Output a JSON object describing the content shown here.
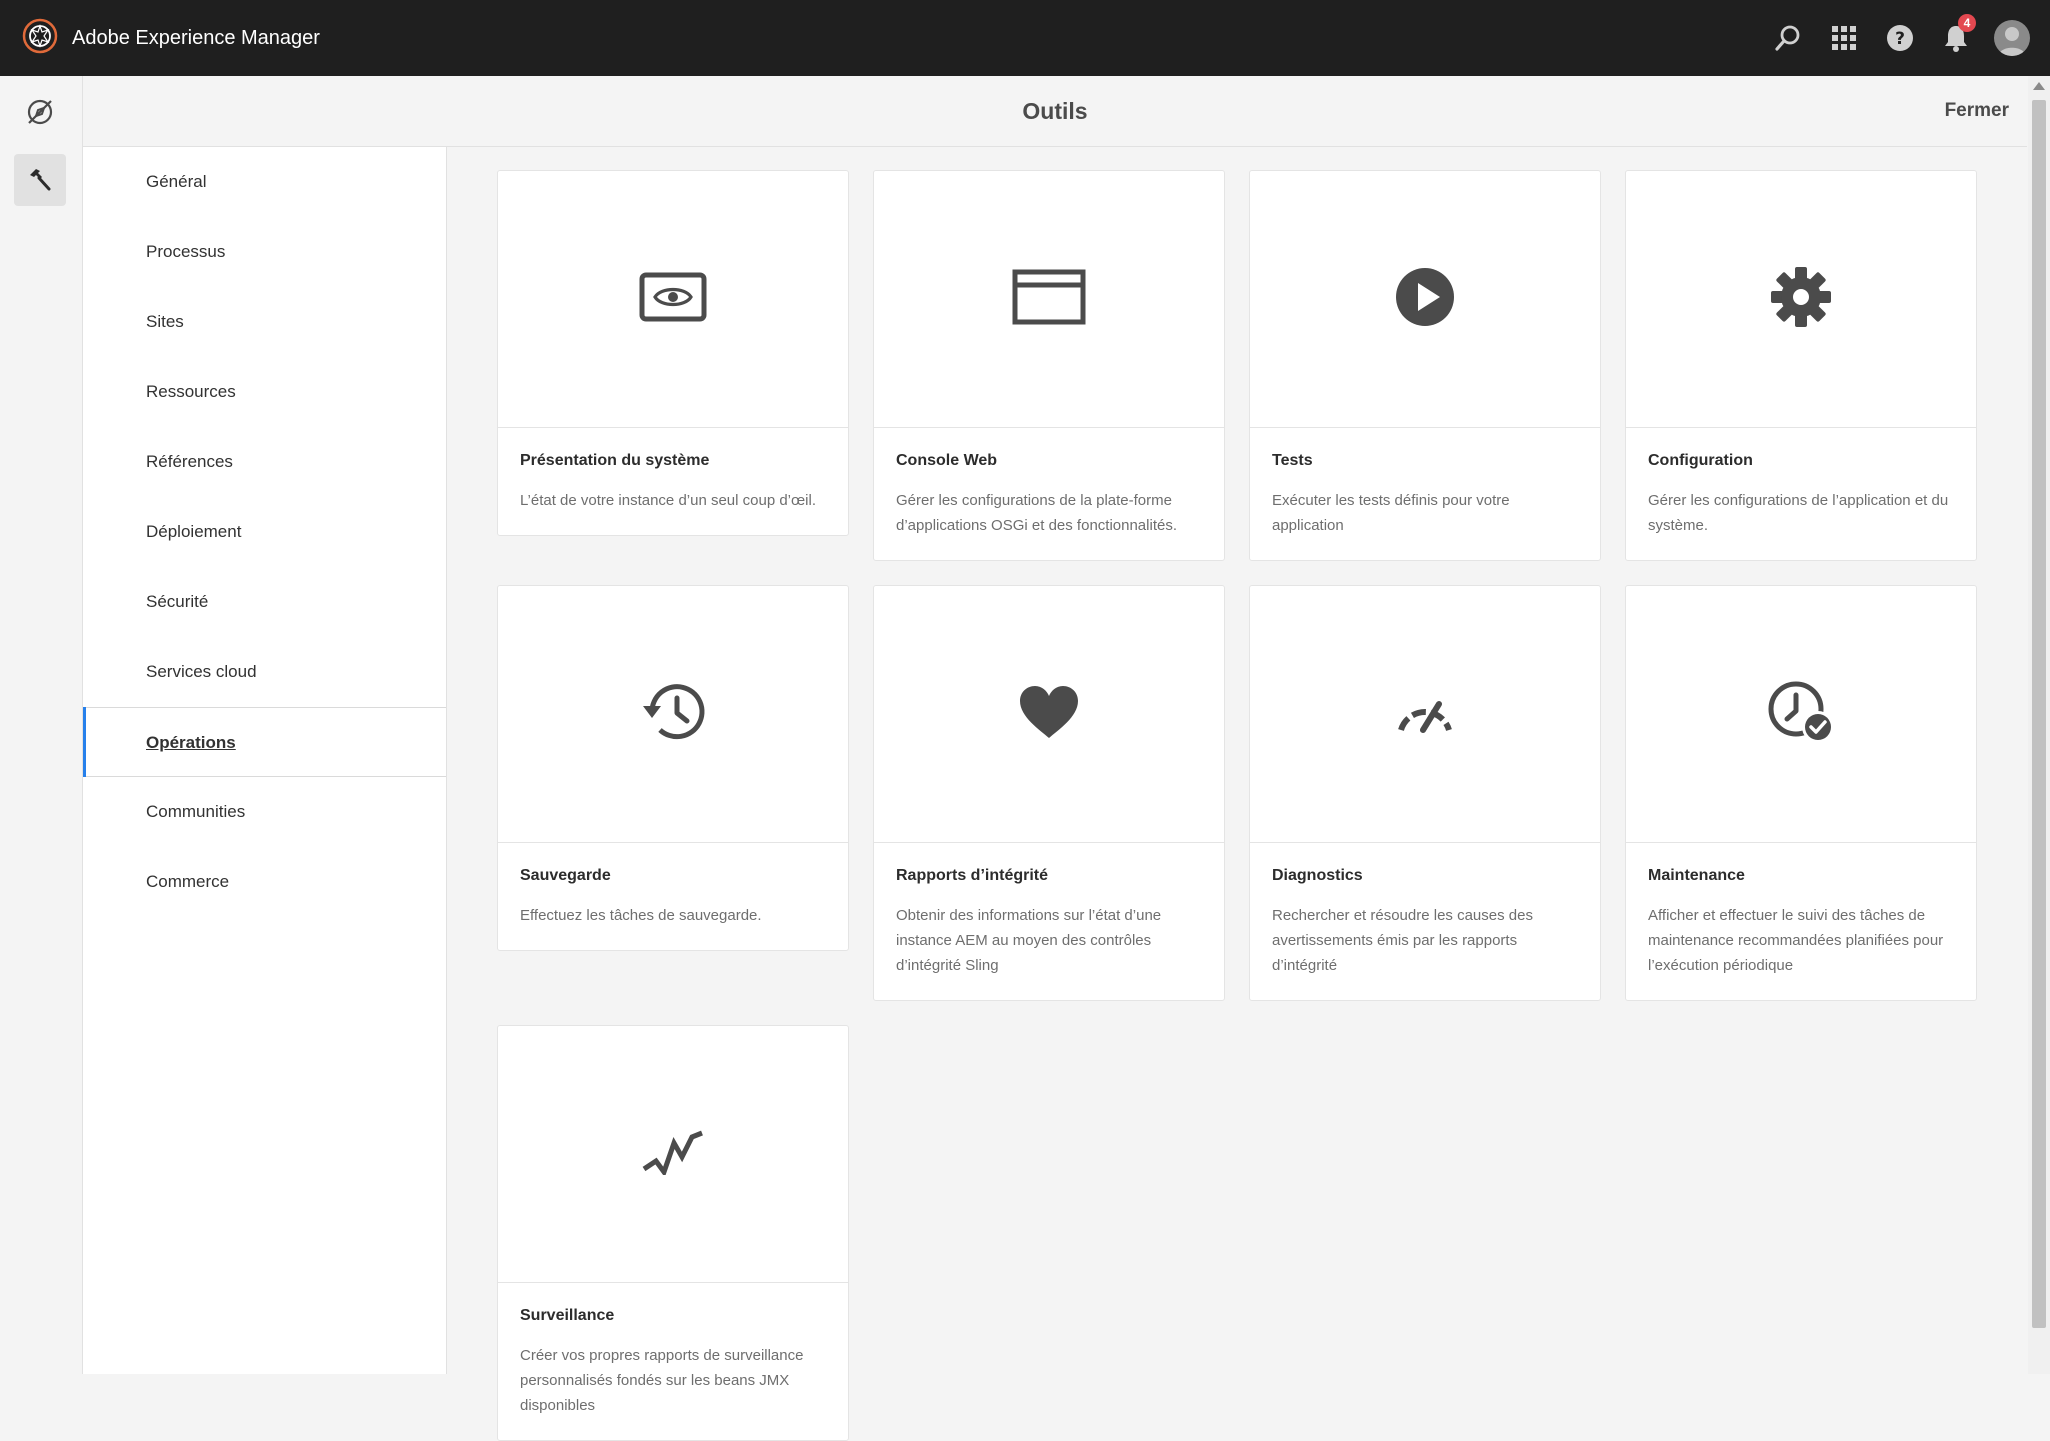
{
  "app": {
    "title": "Adobe Experience Manager",
    "notification_count": "4"
  },
  "topbar_icons": [
    "search-icon",
    "apps-grid-icon",
    "help-icon",
    "notifications-bell-icon",
    "user-avatar"
  ],
  "rail": {
    "items": [
      "navigation-toggle-icon",
      "tools-hammer-icon"
    ]
  },
  "header": {
    "title": "Outils",
    "close_label": "Fermer"
  },
  "categories": [
    {
      "label": "Général"
    },
    {
      "label": "Processus"
    },
    {
      "label": "Sites"
    },
    {
      "label": "Ressources"
    },
    {
      "label": "Références"
    },
    {
      "label": "Déploiement"
    },
    {
      "label": "Sécurité"
    },
    {
      "label": "Services cloud"
    },
    {
      "label": "Opérations",
      "active": true
    },
    {
      "label": "Communities"
    },
    {
      "label": "Commerce"
    }
  ],
  "cards": [
    {
      "icon": "system-overview-icon",
      "title": "Présentation du système",
      "description": "L’état de votre instance d’un seul coup d’œil."
    },
    {
      "icon": "web-console-icon",
      "title": "Console Web",
      "description": "Gérer les configurations de la plate-forme d’applications OSGi et des fonctionnalités."
    },
    {
      "icon": "play-icon",
      "title": "Tests",
      "description": "Exécuter les tests définis pour votre application"
    },
    {
      "icon": "gear-icon",
      "title": "Configuration",
      "description": "Gérer les configurations de l’application et du système."
    },
    {
      "icon": "history-icon",
      "title": "Sauvegarde",
      "description": "Effectuez les tâches de sauvegarde."
    },
    {
      "icon": "heart-icon",
      "title": "Rapports d’intégrité",
      "description": "Obtenir des informations sur l’état d’une instance AEM au moyen des contrôles d’intégrité Sling"
    },
    {
      "icon": "gauge-icon",
      "title": "Diagnostics",
      "description": "Rechercher et résoudre les causes des avertissements émis par les rapports d’intégrité"
    },
    {
      "icon": "clock-check-icon",
      "title": "Maintenance",
      "description": "Afficher et effectuer le suivi des tâches de maintenance recommandées planifiées pour l’exécution périodique"
    },
    {
      "icon": "pulse-icon",
      "title": "Surveillance",
      "description": "Créer vos propres rapports de surveillance personnalisés fondés sur les beans JMX disponibles"
    }
  ],
  "colors": {
    "topbar": "#1f1f1f",
    "background": "#f4f4f4",
    "card": "#ffffff",
    "icon": "#4b4b4b",
    "accent": "#2680eb",
    "badge": "#e34850"
  }
}
